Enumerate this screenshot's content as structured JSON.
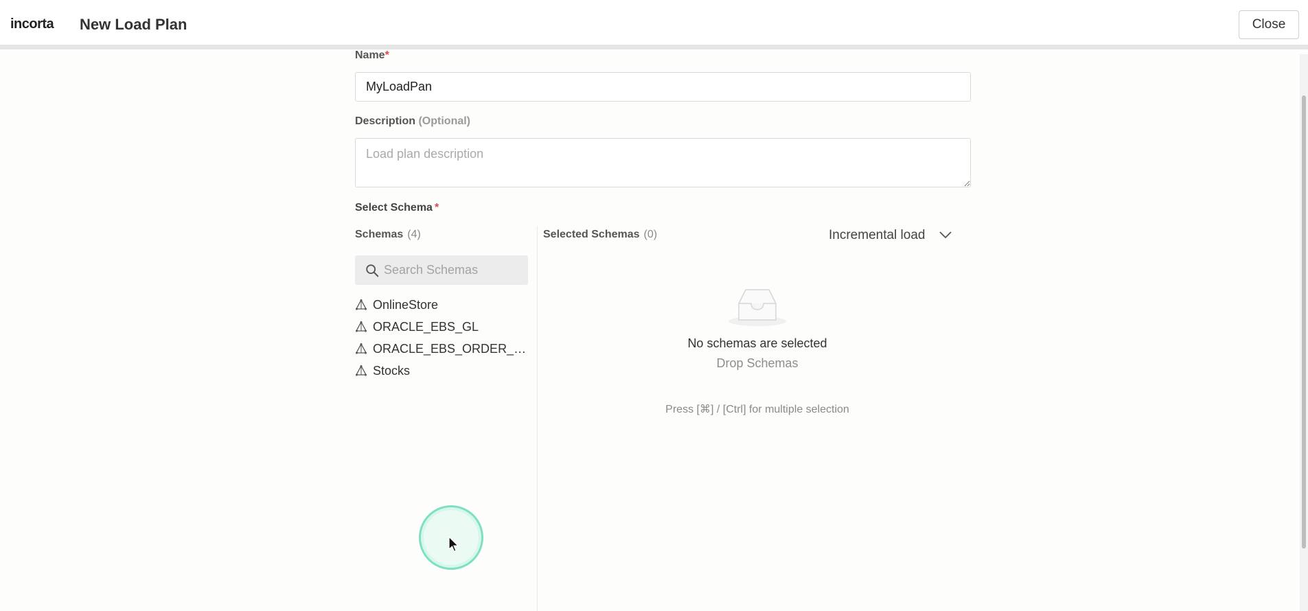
{
  "header": {
    "logo": "incorta",
    "title": "New Load Plan",
    "close_label": "Close"
  },
  "form": {
    "name_label": "Name",
    "name_required_mark": "*",
    "name_value": "MyLoadPan",
    "description_label": "Description",
    "description_optional": "(Optional)",
    "description_placeholder": "Load plan description",
    "select_schema_label": "Select Schema",
    "select_schema_required_mark": "*"
  },
  "schemas_panel": {
    "title": "Schemas",
    "count": "(4)",
    "search_placeholder": "Search Schemas",
    "items": [
      {
        "label": "OnlineStore",
        "icon": "schema-icon"
      },
      {
        "label": "ORACLE_EBS_GL",
        "icon": "schema-icon"
      },
      {
        "label": "ORACLE_EBS_ORDER_MA...",
        "icon": "schema-icon"
      },
      {
        "label": "Stocks",
        "icon": "schema-icon"
      }
    ]
  },
  "selected_panel": {
    "title": "Selected Schemas",
    "count": "(0)",
    "load_type": "Incremental load",
    "empty_title": "No schemas are selected",
    "empty_subtitle": "Drop Schemas",
    "hint": "Press [⌘] / [Ctrl] for multiple selection"
  },
  "colors": {
    "required": "#e04848",
    "cursor_ring": "#7ee0c1"
  }
}
